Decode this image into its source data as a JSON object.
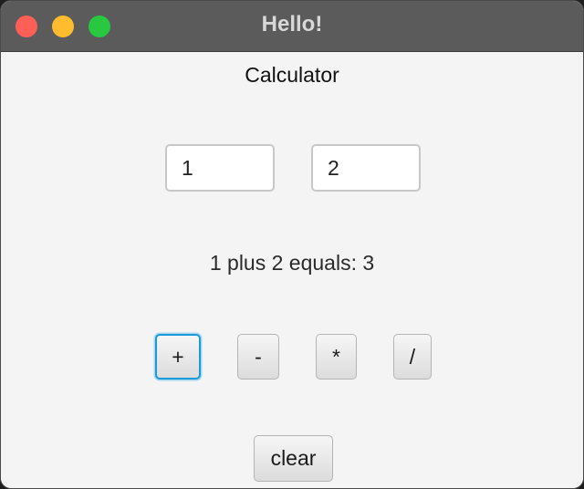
{
  "window": {
    "title": "Hello!"
  },
  "main": {
    "heading": "Calculator",
    "operand_a": "1",
    "operand_b": "2",
    "result_text": "1 plus 2 equals: 3"
  },
  "buttons": {
    "plus": "+",
    "minus": "-",
    "multiply": "*",
    "divide": "/",
    "clear": "clear"
  },
  "colors": {
    "titlebar": "#5b5b5b",
    "close": "#ff5f57",
    "minimize": "#febc2e",
    "maximize": "#28c840",
    "focus_accent": "#1a9ad6",
    "background": "#f4f4f4"
  }
}
